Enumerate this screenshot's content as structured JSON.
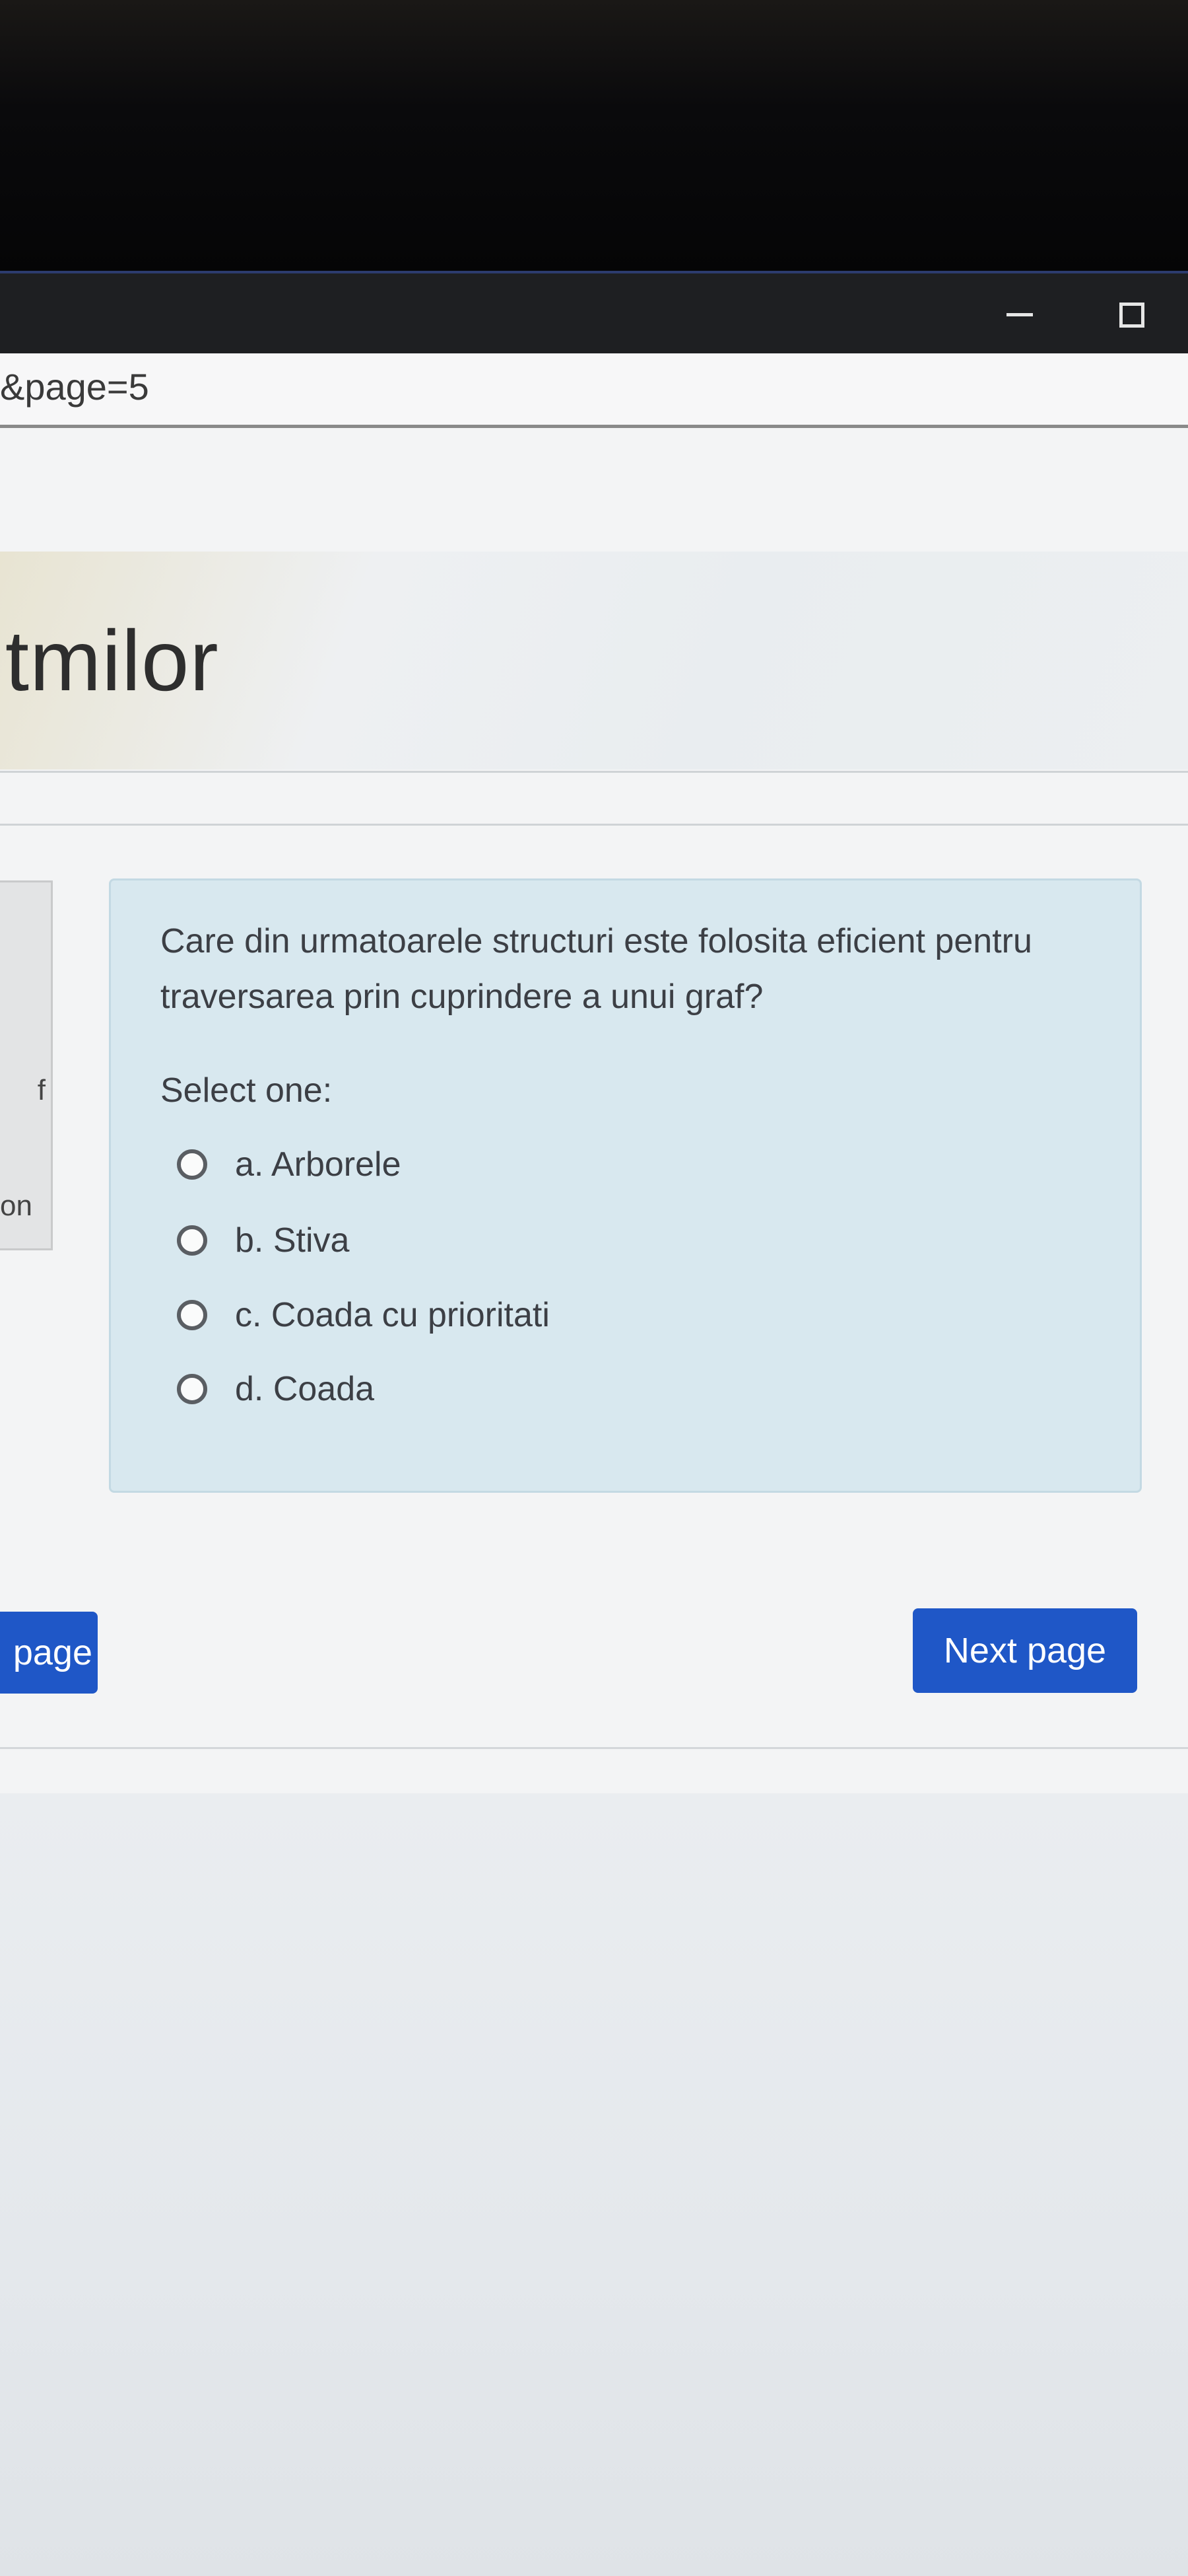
{
  "window": {
    "minimize_icon": "minimize-icon",
    "maximize_icon": "maximize-icon"
  },
  "browser": {
    "url_fragment": "&page=5"
  },
  "page": {
    "title_fragment": "itmilor"
  },
  "sidebar_card": {
    "fragment_1": "f",
    "fragment_2": "on"
  },
  "question": {
    "text": "Care din urmatoarele structuri este folosita eficient pentru traversarea prin cuprindere a unui graf?",
    "prompt": "Select one:",
    "options": [
      {
        "label": "a. Arborele",
        "selected": false
      },
      {
        "label": "b. Stiva",
        "selected": false
      },
      {
        "label": "c. Coada cu prioritati",
        "selected": false
      },
      {
        "label": "d. Coada",
        "selected": false
      }
    ]
  },
  "navigation": {
    "previous_label": "page",
    "next_label": "Next page"
  },
  "colors": {
    "accent": "#1f57c7",
    "question_background": "#d8e8ef"
  }
}
